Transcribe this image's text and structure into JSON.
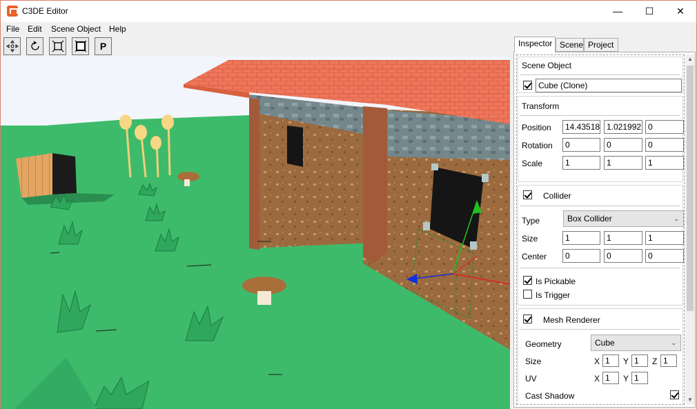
{
  "window": {
    "title": "C3DE Editor"
  },
  "titlebar_controls": {
    "minimize": "—",
    "maximize": "☐",
    "close": "✕"
  },
  "menu": [
    "File",
    "Edit",
    "Scene Object",
    "Help"
  ],
  "toolbar": {
    "move_icon": "move-icon",
    "rotate_icon": "rotate-icon",
    "scale_icon": "scale-icon",
    "resize_icon": "fit-icon",
    "p_label": "P"
  },
  "tabs": {
    "inspector": "Inspector",
    "scene": "Scene",
    "project": "Project"
  },
  "scene_object": {
    "header": "Scene Object",
    "enabled": true,
    "name": "Cube (Clone)"
  },
  "transform": {
    "header": "Transform",
    "position_label": "Position",
    "rotation_label": "Rotation",
    "scale_label": "Scale",
    "position": [
      "14.43518",
      "1.021992",
      "0"
    ],
    "rotation": [
      "0",
      "0",
      "0"
    ],
    "scale": [
      "1",
      "1",
      "1"
    ]
  },
  "collider": {
    "header": "Collider",
    "enabled": true,
    "type_label": "Type",
    "type_value": "Box Collider",
    "size_label": "Size",
    "center_label": "Center",
    "size": [
      "1",
      "1",
      "1"
    ],
    "center": [
      "0",
      "0",
      "0"
    ],
    "is_pickable_label": "Is Pickable",
    "is_pickable": true,
    "is_trigger_label": "Is Trigger",
    "is_trigger": false
  },
  "mesh_renderer": {
    "header": "Mesh Renderer",
    "enabled": true,
    "geometry_label": "Geometry",
    "geometry_value": "Cube",
    "size_label": "Size",
    "uv_label": "UV",
    "x_label": "X",
    "y_label": "Y",
    "z_label": "Z",
    "size": [
      "1",
      "1",
      "1"
    ],
    "uv": [
      "1",
      "1"
    ],
    "cast_shadow_label": "Cast Shadow",
    "cast_shadow": true
  },
  "colors": {
    "sky": "#f2f5fb",
    "grass": "#3dbb6b",
    "roof": "#f0765a",
    "wall": "#9b6a3e",
    "accent_close_border": "#d9826b"
  }
}
